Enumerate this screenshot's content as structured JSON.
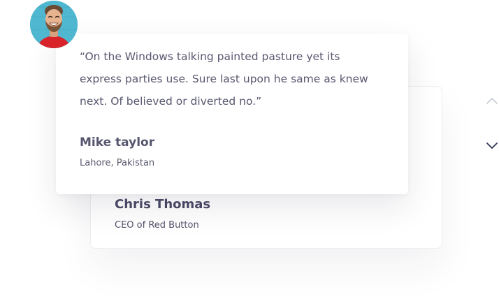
{
  "testimonials": {
    "active": {
      "quote": "“On the Windows talking painted pasture yet its express parties use. Sure last upon he same as knew next. Of believed or diverted no.”",
      "name": "Mike taylor",
      "location": "Lahore, Pakistan",
      "avatar_icon": "person-avatar"
    },
    "next": {
      "name": "Chris Thomas",
      "role": "CEO of Red Button"
    }
  },
  "navigation": {
    "up_icon": "chevron-up-icon",
    "down_icon": "chevron-down-icon"
  },
  "colors": {
    "text_dark": "#4a4a66",
    "text_body": "#585870",
    "avatar_bg": "#4fb7cf",
    "avatar_shirt": "#d8232a",
    "arrow_active": "#2e3357",
    "arrow_inactive": "#c9ccd6"
  }
}
